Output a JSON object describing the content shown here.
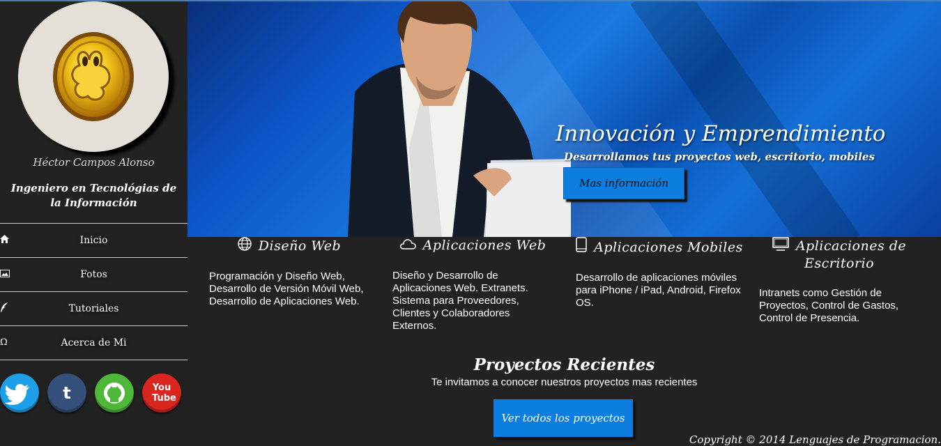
{
  "profile": {
    "name": "Héctor Campos Alonso",
    "profession": "Ingeniero en Tecnológias de la Información"
  },
  "nav": {
    "items": [
      {
        "label": "Inicio",
        "icon": "home-icon"
      },
      {
        "label": "Fotos",
        "icon": "image-icon"
      },
      {
        "label": "Tutoriales",
        "icon": "feather-icon"
      },
      {
        "label": "Acerca de Mi",
        "icon": "omega-icon"
      }
    ]
  },
  "social": [
    {
      "name": "twitter",
      "color": "#1ea0e8"
    },
    {
      "name": "tumblr",
      "color": "#35507a"
    },
    {
      "name": "github",
      "color": "#4fb83a"
    },
    {
      "name": "youtube",
      "color": "#d9261f",
      "label": "You Tube"
    }
  ],
  "hero": {
    "title": "Innovación y Emprendimiento",
    "subtitle": "Desarrollamos tus proyectos web, escritorio, mobiles",
    "button": "Mas información"
  },
  "services": [
    {
      "title": "Diseño  Web",
      "icon": "globe-icon",
      "text": "Programación y Diseño Web, Desarrollo de Versión Móvil Web, Desarrollo de Aplicaciones Web."
    },
    {
      "title": "Aplicaciones  Web",
      "icon": "cloud-icon",
      "text": "Diseño y Desarrollo de Aplicaciones Web. Extranets. Sistema para Proveedores, Clientes y Colaboradores Externos."
    },
    {
      "title": "Aplicaciones  Mobiles",
      "icon": "phone-icon",
      "text": "Desarrollo de aplicaciones móviles para iPhone / iPad, Android, Firefox OS."
    },
    {
      "title": "Aplicaciones  de Escritorio",
      "icon": "monitor-icon",
      "text": "Intranets como Gestión de Proyectos, Control de Gastos, Control de Presencia."
    }
  ],
  "projects": {
    "title": "Proyectos Recientes",
    "subtitle": "Te invitamos a conocer nuestros proyectos mas recientes",
    "button": "Ver todos los proyectos"
  },
  "footer": {
    "copyright": "Copyright © 2014 Lenguajes de Programacion."
  },
  "colors": {
    "accent": "#0d7ee0",
    "background": "#222222"
  }
}
